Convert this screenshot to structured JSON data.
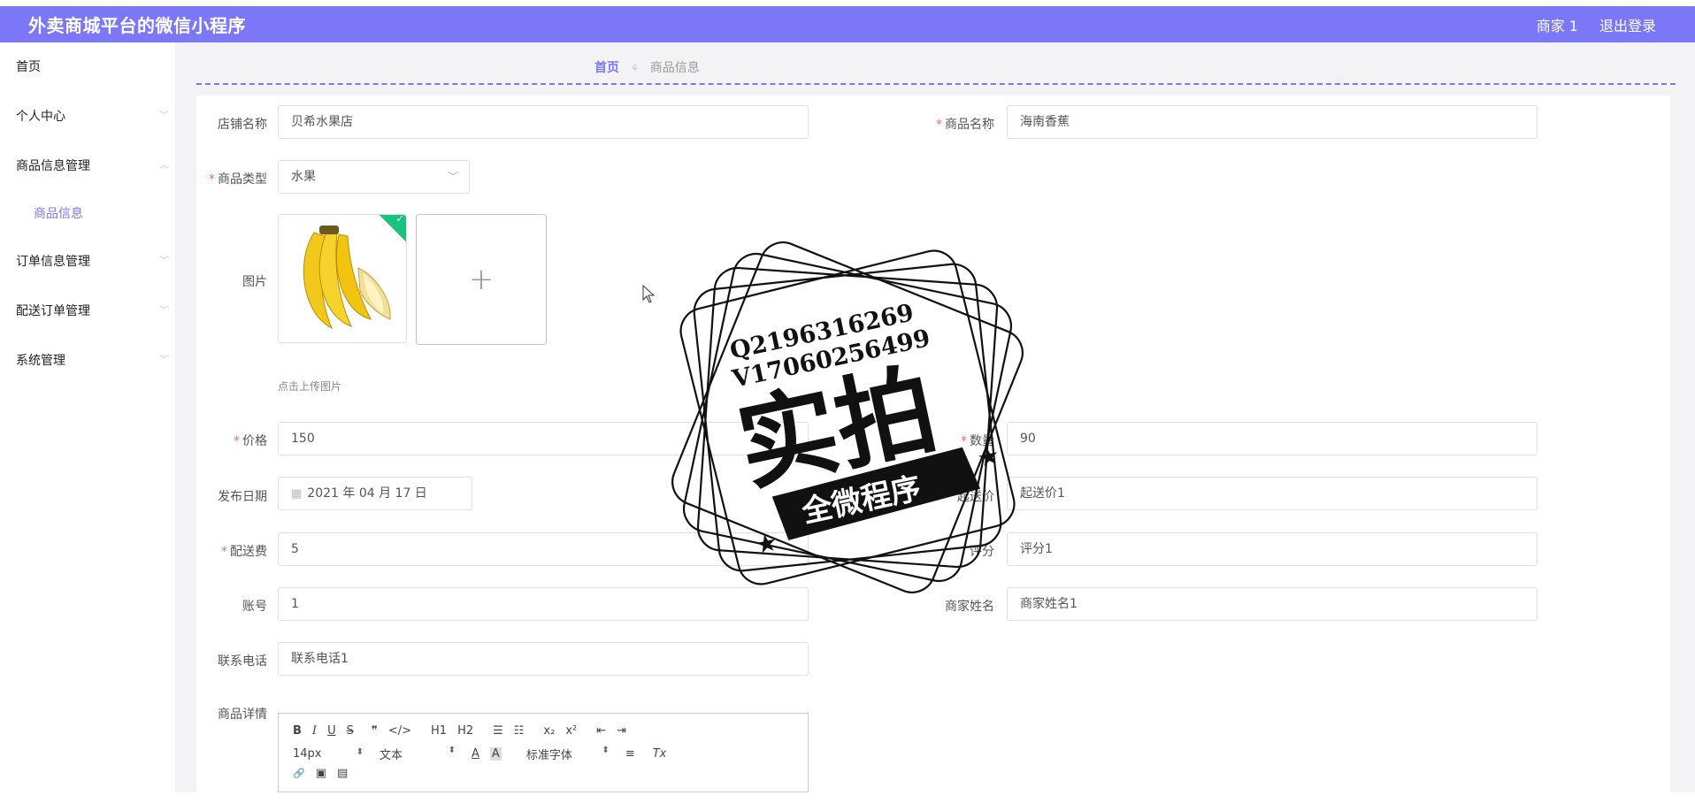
{
  "header": {
    "app_title": "外卖商城平台的微信小程序",
    "user": "商家 1",
    "logout": "退出登录"
  },
  "sidebar": {
    "items": [
      {
        "label": "首页",
        "has_chevron": false
      },
      {
        "label": "个人中心",
        "has_chevron": true
      },
      {
        "label": "商品信息管理",
        "has_chevron": true,
        "expanded": true
      },
      {
        "label": "订单信息管理",
        "has_chevron": true
      },
      {
        "label": "配送订单管理",
        "has_chevron": true
      },
      {
        "label": "系统管理",
        "has_chevron": true
      }
    ],
    "sub_item": "商品信息"
  },
  "breadcrumb": {
    "home": "首页",
    "separator": "⚘",
    "current": "商品信息"
  },
  "form": {
    "shop_name": {
      "label": "店铺名称",
      "value": "贝希水果店"
    },
    "product_name": {
      "label": "商品名称",
      "value": "海南香蕉"
    },
    "product_type": {
      "label": "商品类型",
      "value": "水果"
    },
    "image": {
      "label": "图片",
      "upload_hint": "点击上传图片",
      "add_symbol": "+",
      "success_mark": "✓"
    },
    "price": {
      "label": "价格",
      "value": "150"
    },
    "quantity": {
      "label": "数量",
      "value": "90"
    },
    "publish_date": {
      "label": "发布日期",
      "value": "2021 年 04 月 17 日"
    },
    "min_price": {
      "label": "起送价",
      "value": "起送价1"
    },
    "delivery_fee": {
      "label": "配送费",
      "value": "5"
    },
    "rating": {
      "label": "评分",
      "value": "评分1"
    },
    "account": {
      "label": "账号",
      "value": "1"
    },
    "merchant_name": {
      "label": "商家姓名",
      "value": "商家姓名1"
    },
    "phone": {
      "label": "联系电话",
      "value": "联系电话1"
    },
    "details": {
      "label": "商品详情"
    }
  },
  "editor": {
    "row1": [
      "B",
      "I",
      "U",
      "S",
      "❞",
      "</>",
      "H1",
      "H2",
      "☰",
      "☷",
      "x₂",
      "x²",
      "⇤",
      "⇥"
    ],
    "font_size": "14px",
    "block_type": "文本",
    "color_a": "A",
    "bg_a": "A",
    "font_family": "标准字体",
    "align": "≡",
    "clear": "Tx",
    "row3": [
      "🔗",
      "▣",
      "▤"
    ]
  },
  "watermark": {
    "line1": "Q2196316269",
    "line2": "V17060256499",
    "main": "实拍",
    "banner": "全微程序"
  },
  "colors": {
    "accent": "#7b77f7",
    "required": "#f56c6c",
    "success": "#19c37d"
  }
}
